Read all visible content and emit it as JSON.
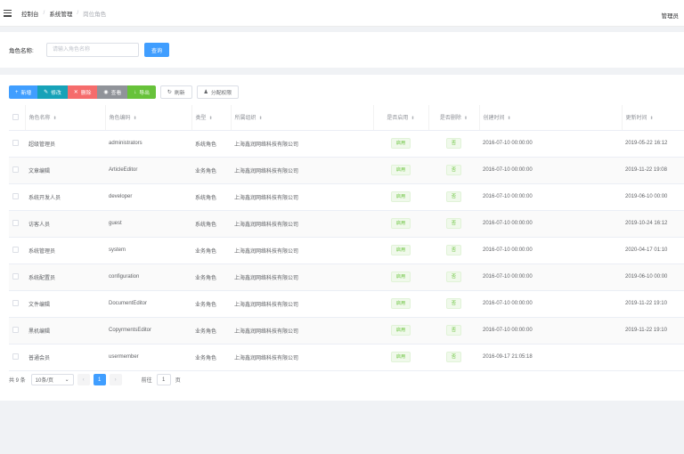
{
  "breadcrumb": [
    "控制台",
    "系统管理",
    "岗位角色"
  ],
  "user": "管理员",
  "search": {
    "label": "角色名称:",
    "placeholder": "请输入角色名称",
    "button": "查询"
  },
  "toolbar": {
    "add": "新增",
    "edit": "修改",
    "delete": "删除",
    "view": "查看",
    "export": "导出",
    "refresh": "刷新",
    "assign": "分配权限"
  },
  "table": {
    "columns": [
      "角色名称",
      "角色编码",
      "类型",
      "所属组织",
      "是否启用",
      "是否删除",
      "创建时间",
      "更新时间"
    ],
    "rows": [
      {
        "name": "超级管理员",
        "code": "administrators",
        "type": "系统角色",
        "org": "上海鑫润网络科技有限公司",
        "enabled": "启用",
        "deleted": "否",
        "created": "2016-07-10 00:00:00",
        "updated": "2019-05-22 16:12"
      },
      {
        "name": "文章编辑",
        "code": "ArticleEditor",
        "type": "业务角色",
        "org": "上海鑫润网络科技有限公司",
        "enabled": "启用",
        "deleted": "否",
        "created": "2016-07-10 00:00:00",
        "updated": "2019-11-22 19:08"
      },
      {
        "name": "系统开发人员",
        "code": "developer",
        "type": "系统角色",
        "org": "上海鑫润网络科技有限公司",
        "enabled": "启用",
        "deleted": "否",
        "created": "2016-07-10 00:00:00",
        "updated": "2019-06-10 00:00"
      },
      {
        "name": "访客人员",
        "code": "guest",
        "type": "系统角色",
        "org": "上海鑫润网络科技有限公司",
        "enabled": "启用",
        "deleted": "否",
        "created": "2016-07-10 00:00:00",
        "updated": "2019-10-24 16:12"
      },
      {
        "name": "系统管理员",
        "code": "system",
        "type": "业务角色",
        "org": "上海鑫润网络科技有限公司",
        "enabled": "启用",
        "deleted": "否",
        "created": "2016-07-10 00:00:00",
        "updated": "2020-04-17 01:10"
      },
      {
        "name": "系统配置员",
        "code": "configuration",
        "type": "业务角色",
        "org": "上海鑫润网络科技有限公司",
        "enabled": "启用",
        "deleted": "否",
        "created": "2016-07-10 00:00:00",
        "updated": "2019-06-10 00:00"
      },
      {
        "name": "文件编辑",
        "code": "DocumentEditor",
        "type": "业务角色",
        "org": "上海鑫润网络科技有限公司",
        "enabled": "启用",
        "deleted": "否",
        "created": "2016-07-10 00:00:00",
        "updated": "2019-11-22 19:10"
      },
      {
        "name": "黑机编辑",
        "code": "CopyrmentsEditor",
        "type": "业务角色",
        "org": "上海鑫润网络科技有限公司",
        "enabled": "启用",
        "deleted": "否",
        "created": "2016-07-10 00:00:00",
        "updated": "2019-11-22 19:10"
      },
      {
        "name": "普通会员",
        "code": "usermember",
        "type": "业务角色",
        "org": "上海鑫润网络科技有限公司",
        "enabled": "启用",
        "deleted": "否",
        "created": "2016-09-17 21:05:18",
        "updated": ""
      }
    ]
  },
  "pagination": {
    "total": "共 9 条",
    "page_size": "10条/页",
    "current_page": "1",
    "goto_label": "前往",
    "goto_value": "1",
    "goto_unit": "页"
  }
}
